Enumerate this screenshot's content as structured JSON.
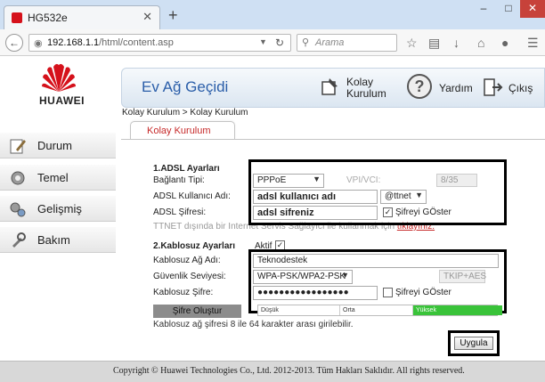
{
  "browser": {
    "tab_title": "HG532e",
    "tab_close": "✕",
    "new_tab": "+",
    "url_host": "192.168.1.1",
    "url_path": "/html/content.asp",
    "search_placeholder": "Arama",
    "accent_color": "#d5111b"
  },
  "brand": {
    "logo_text": "HUAWEI"
  },
  "header": {
    "title": "Ev Ağ Geçidi",
    "kolay_kurulum": "Kolay Kurulum",
    "yardim": "Yardım",
    "cikis": "Çıkış",
    "yardim_glyph": "?"
  },
  "breadcrumb": "Kolay Kurulum > Kolay Kurulum",
  "content_tab": "Kolay Kurulum",
  "sidebar": {
    "items": [
      {
        "label": "Durum",
        "icon": "pencil-icon"
      },
      {
        "label": "Temel",
        "icon": "gear-icon"
      },
      {
        "label": "Gelişmiş",
        "icon": "gears-icon"
      },
      {
        "label": "Bakım",
        "icon": "tools-icon"
      }
    ]
  },
  "adsl": {
    "section_title": "1.ADSL Ayarları",
    "connection_type_label": "Bağlantı Tipi:",
    "connection_type_value": "PPPoE",
    "vpivci_label": "VPI/VCI:",
    "vpivci_value": "8/35",
    "username_label": "ADSL Kullanıcı Adı:",
    "username_value": "adsl kullanıcı adı",
    "domain_value": "@ttnet",
    "password_label": "ADSL Şifresi:",
    "password_value": "adsl sifreniz",
    "show_password_label": "Şifreyi GÖster",
    "show_password_checked": true,
    "note_text": "TTNET dışında bir Internet Servis Sağlayıcı ile kullanmak için",
    "note_link": "tıklayınız."
  },
  "wifi": {
    "section_title": "2.Kablosuz Ayarları",
    "active_label": "Aktif",
    "active_checked": true,
    "ssid_label": "Kablosuz Ağ Adı:",
    "ssid_value": "Teknodestek",
    "security_label": "Güvenlik Seviyesi:",
    "security_value": "WPA-PSK/WPA2-PSK",
    "encryption_value": "TKIP+AES",
    "password_label": "Kablosuz Şifre:",
    "password_value": "●●●●●●●●●●●●●●●●●",
    "show_password_label": "Şifreyi GÖster",
    "show_password_checked": false,
    "strength_weak": "Düşük",
    "strength_mid": "Orta",
    "strength_strong": "Yüksek",
    "strength_level": 1.0,
    "generate_button": "Şifre Oluştur",
    "hint": "Kablosuz ağ şifresi 8 ile 64 karakter arası girilebilir."
  },
  "apply_button": "Uygula",
  "footer": "Copyright © Huawei Technologies Co., Ltd. 2012-2013. Tüm Hakları Saklıdır. All rights reserved."
}
